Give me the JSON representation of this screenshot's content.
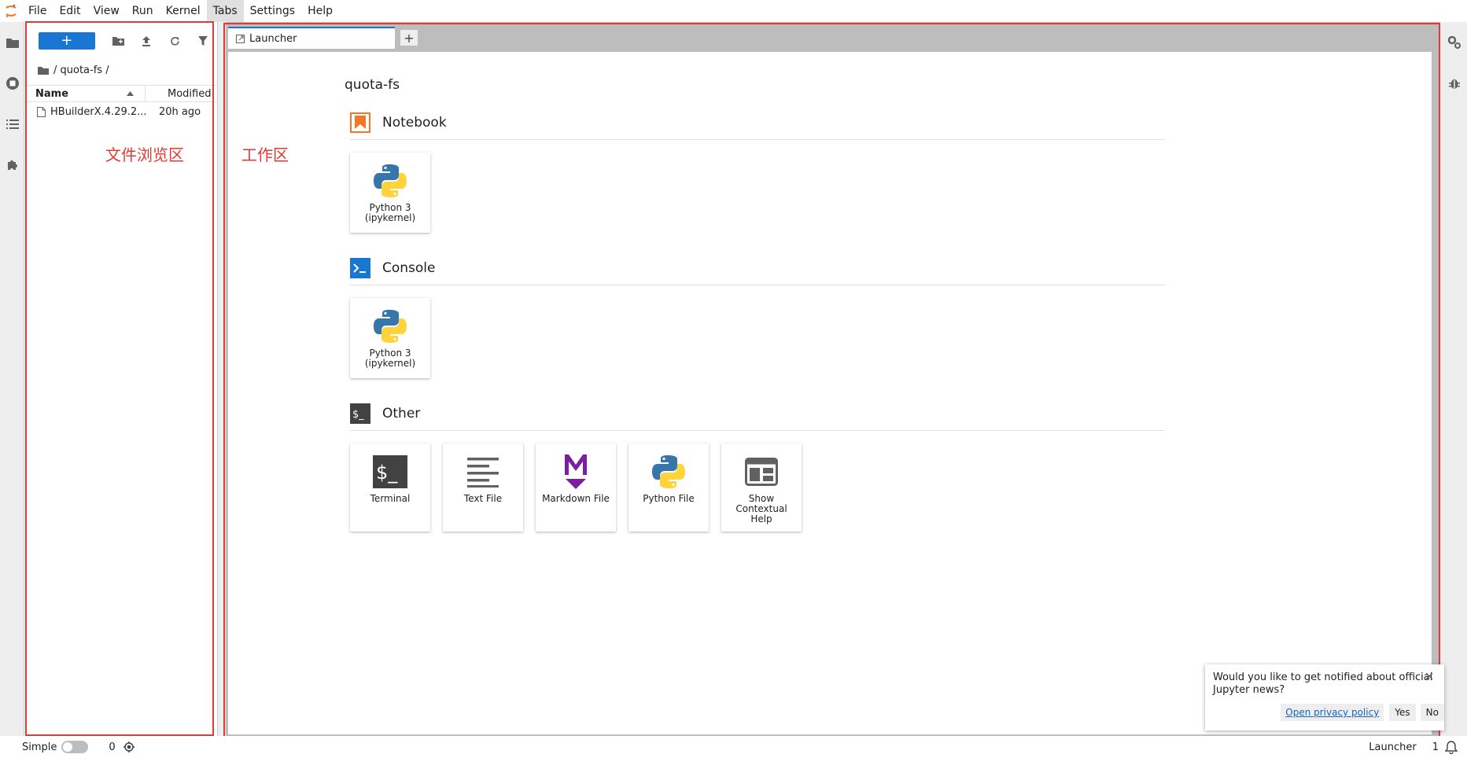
{
  "menu": {
    "items": [
      "File",
      "Edit",
      "View",
      "Run",
      "Kernel",
      "Tabs",
      "Settings",
      "Help"
    ],
    "active_index": 5
  },
  "file_browser": {
    "new_button_label": "+",
    "breadcrumb": "/ quota-fs /",
    "columns": {
      "name": "Name",
      "modified": "Modified"
    },
    "files": [
      {
        "name": "HBuilderX.4.29.2...",
        "modified": "20h ago"
      }
    ]
  },
  "annotations": {
    "file_area": "文件浏览区",
    "work_area": "工作区"
  },
  "tabs": [
    {
      "label": "Launcher"
    }
  ],
  "add_tab_label": "+",
  "launcher": {
    "cwd": "quota-fs",
    "sections": [
      {
        "title": "Notebook",
        "cards": [
          {
            "label": "Python 3 (ipykernel)"
          }
        ]
      },
      {
        "title": "Console",
        "cards": [
          {
            "label": "Python 3 (ipykernel)"
          }
        ]
      },
      {
        "title": "Other",
        "cards": [
          {
            "label": "Terminal"
          },
          {
            "label": "Text File"
          },
          {
            "label": "Markdown File"
          },
          {
            "label": "Python File"
          },
          {
            "label": "Show Contextual Help"
          }
        ]
      }
    ]
  },
  "toast": {
    "message": "Would you like to get notified about official Jupyter news?",
    "privacy_link": "Open privacy policy",
    "yes_label": "Yes",
    "no_label": "No"
  },
  "status": {
    "simple_label": "Simple",
    "terminal_count": "0",
    "mode_label": "Launcher",
    "notification_count": "1"
  },
  "colors": {
    "accent": "#1976d2",
    "annotation_red": "#e53935",
    "notebook_orange": "#f37726",
    "console_blue": "#0d47a1",
    "markdown_purple": "#7b1fa2"
  }
}
